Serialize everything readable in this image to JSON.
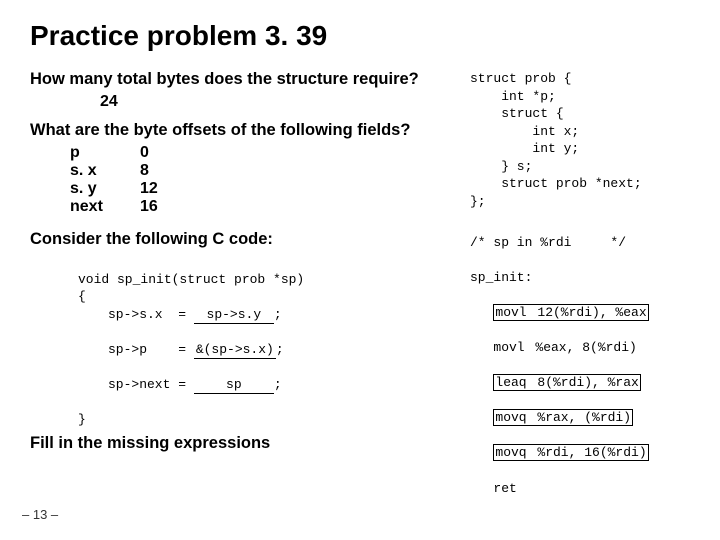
{
  "title": "Practice problem 3. 39",
  "q1": "How many total bytes does the structure require?",
  "a1": "24",
  "q2": "What are the byte offsets of the following fields?",
  "fields": [
    {
      "name": "p",
      "val": "0"
    },
    {
      "name": "s. x",
      "val": "8"
    },
    {
      "name": "s. y",
      "val": "12"
    },
    {
      "name": "next",
      "val": "16"
    }
  ],
  "q3": "Consider the following C code:",
  "ccode": {
    "sig": "void sp_init(struct prob *sp)",
    "open": "{",
    "l1a": "sp->s.x  = ",
    "l1b": "sp->s.y",
    "l1c": ";",
    "l2a": "sp->p    = ",
    "l2b": "&(sp->s.x)",
    "l2c": ";",
    "l3a": "sp->next = ",
    "l3b": "sp",
    "l3c": ";",
    "close": "}"
  },
  "fill_label": "Fill in the missing expressions",
  "struct_code": "struct prob {\n    int *p;\n    struct {\n        int x;\n        int y;\n    } s;\n    struct prob *next;\n};",
  "asm": {
    "comment": "/* sp in %rdi     */",
    "label": "sp_init:",
    "lines": [
      {
        "m": "movl",
        "a": "12(%rdi), %eax",
        "box": true
      },
      {
        "m": "movl",
        "a": "%eax, 8(%rdi)",
        "box": false
      },
      {
        "m": "leaq",
        "a": "8(%rdi), %rax",
        "box": true
      },
      {
        "m": "movq",
        "a": "%rax, (%rdi)",
        "box": true
      },
      {
        "m": "movq",
        "a": "%rdi, 16(%rdi)",
        "box": true
      },
      {
        "m": "ret",
        "a": "",
        "box": false
      }
    ]
  },
  "page": "– 13 –"
}
